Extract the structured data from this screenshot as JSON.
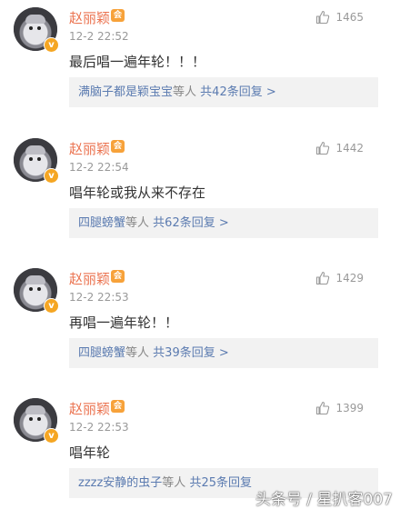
{
  "comments": [
    {
      "author": "赵丽颖",
      "time": "12-2 22:52",
      "likes": "1465",
      "text": "最后唱一遍年轮！！！",
      "reply_user": "满脑子都是颖宝宝",
      "reply_mid": "等人",
      "reply_count": "共42条回复 >"
    },
    {
      "author": "赵丽颖",
      "time": "12-2 22:54",
      "likes": "1442",
      "text": "唱年轮或我从来不存在",
      "reply_user": "四腿螃蟹",
      "reply_mid": "等人",
      "reply_count": "共62条回复 >"
    },
    {
      "author": "赵丽颖",
      "time": "12-2 22:53",
      "likes": "1429",
      "text": "再唱一遍年轮！！",
      "reply_user": "四腿螃蟹",
      "reply_mid": "等人",
      "reply_count": "共39条回复 >"
    },
    {
      "author": "赵丽颖",
      "time": "12-2 22:53",
      "likes": "1399",
      "text": "唱年轮",
      "reply_user": "zzzz安静的虫子",
      "reply_mid": "等人",
      "reply_count": "共25条回复"
    }
  ],
  "badges": {
    "verified": "v",
    "member": "会"
  },
  "watermark": "头条号 / 星扒客007",
  "colors": {
    "name": "#eb7350",
    "link": "#5b7bb0",
    "reply_bg": "#f2f2f2",
    "meta": "#999999"
  },
  "icons": {
    "like": "thumbs-up-icon",
    "verified": "verified-badge-icon"
  }
}
